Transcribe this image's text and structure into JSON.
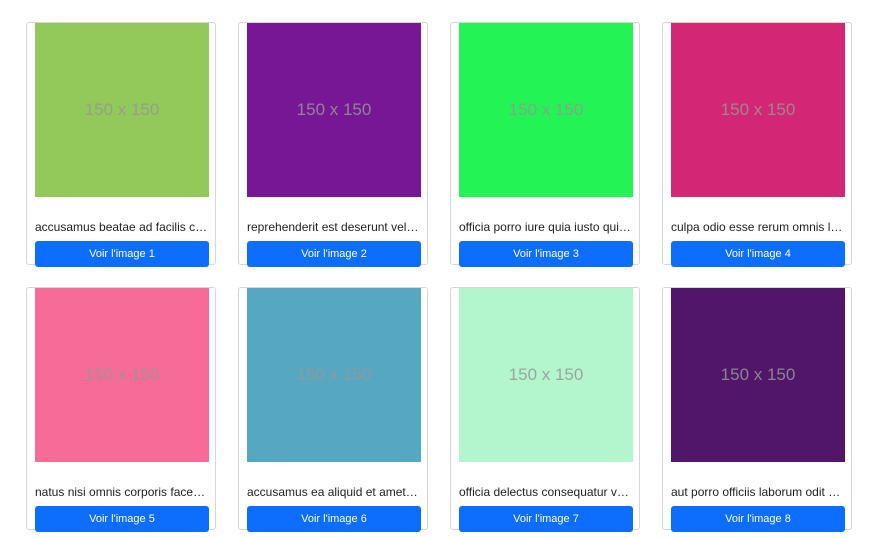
{
  "cards": [
    {
      "image_label": "150 x 150",
      "image_color": "#93c95a",
      "caption": "accusamus beatae ad facilis cum similique qui sunt",
      "button_label": "Voir l'image 1"
    },
    {
      "image_label": "150 x 150",
      "image_color": "#771796",
      "caption": "reprehenderit est deserunt velit ipsam",
      "button_label": "Voir l'image 2"
    },
    {
      "image_label": "150 x 150",
      "image_color": "#24f355",
      "caption": "officia porro iure quia iusto qui ipsa ut modi",
      "button_label": "Voir l'image 3"
    },
    {
      "image_label": "150 x 150",
      "image_color": "#d32776",
      "caption": "culpa odio esse rerum omnis laboriosam voluptate repudiandae",
      "button_label": "Voir l'image 4"
    },
    {
      "image_label": "150 x 150",
      "image_color": "#f66b97",
      "caption": "natus nisi omnis corporis facere molestiae rerum in",
      "button_label": "Voir l'image 5"
    },
    {
      "image_label": "150 x 150",
      "image_color": "#56a8c2",
      "caption": "accusamus ea aliquid et amet sequi nemo",
      "button_label": "Voir l'image 6"
    },
    {
      "image_label": "150 x 150",
      "image_color": "#b3f6cd",
      "caption": "officia delectus consequatur vero aut veniam explicabo molestias",
      "button_label": "Voir l'image 7"
    },
    {
      "image_label": "150 x 150",
      "image_color": "#51166a",
      "caption": "aut porro officiis laborum odit ea laudantium corporis",
      "button_label": "Voir l'image 8"
    }
  ]
}
